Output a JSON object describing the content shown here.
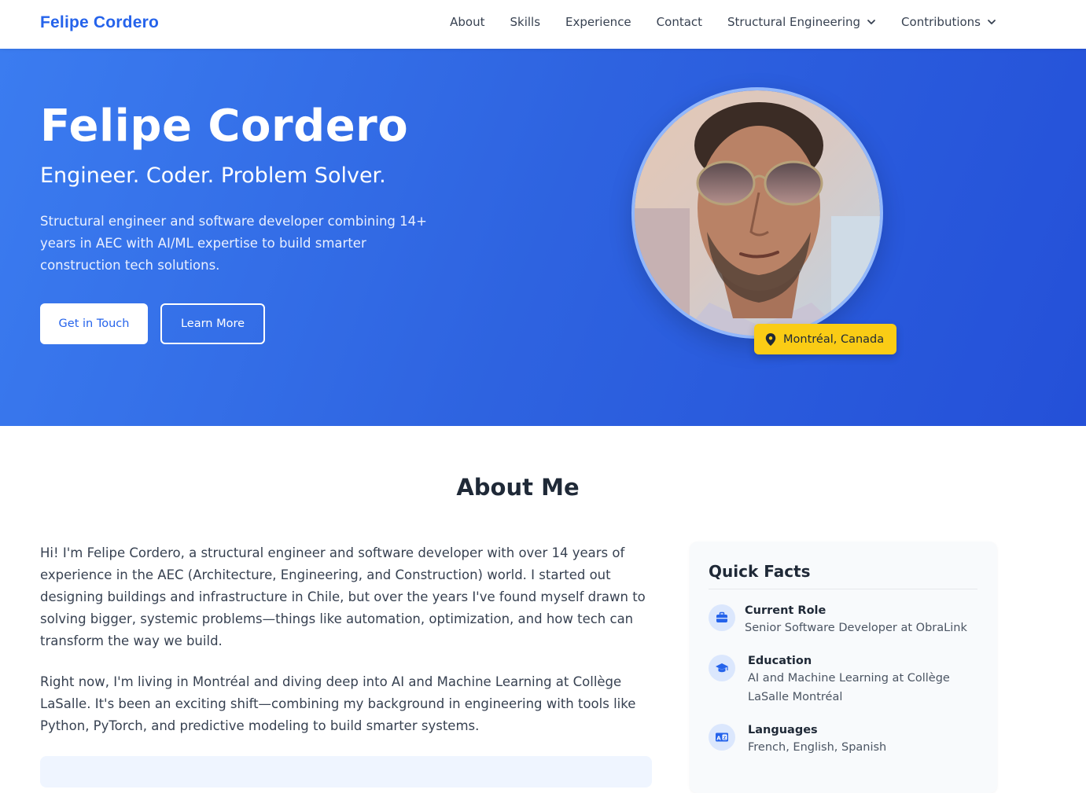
{
  "nav": {
    "brand": "Felipe Cordero",
    "links": [
      "About",
      "Skills",
      "Experience",
      "Contact"
    ],
    "dropdowns": [
      "Structural Engineering",
      "Contributions"
    ]
  },
  "hero": {
    "name": "Felipe Cordero",
    "tagline": "Engineer. Coder. Problem Solver.",
    "description": "Structural engineer and software developer combining 14+ years in AEC with AI/ML expertise to build smarter construction tech solutions.",
    "primary_button": "Get in Touch",
    "secondary_button": "Learn More",
    "location": "Montréal, Canada",
    "avatar_alt": "Felipe Cordero profile photo"
  },
  "about": {
    "title": "About Me",
    "paragraphs": [
      "Hi! I'm Felipe Cordero, a structural engineer and software developer with over 14 years of experience in the AEC (Architecture, Engineering, and Construction) world. I started out designing buildings and infrastructure in Chile, but over the years I've found myself drawn to solving bigger, systemic problems—things like automation, optimization, and how tech can transform the way we build.",
      "Right now, I'm living in Montréal and diving deep into AI and Machine Learning at Collège LaSalle. It's been an exciting shift—combining my background in engineering with tools like Python, PyTorch, and predictive modeling to build smarter systems."
    ]
  },
  "quick_facts": {
    "title": "Quick Facts",
    "items": [
      {
        "label": "Current Role",
        "value": "Senior Software Developer at ObraLink",
        "icon": "briefcase-icon"
      },
      {
        "label": "Education",
        "value": "AI and Machine Learning at Collège LaSalle Montréal",
        "icon": "graduation-cap-icon"
      },
      {
        "label": "Languages",
        "value": "French, English, Spanish",
        "icon": "language-icon"
      }
    ]
  },
  "colors": {
    "brand": "#2563eb",
    "hero_gradient_start": "#3b7cf0",
    "hero_gradient_end": "#2450d8",
    "badge": "#facc15"
  }
}
